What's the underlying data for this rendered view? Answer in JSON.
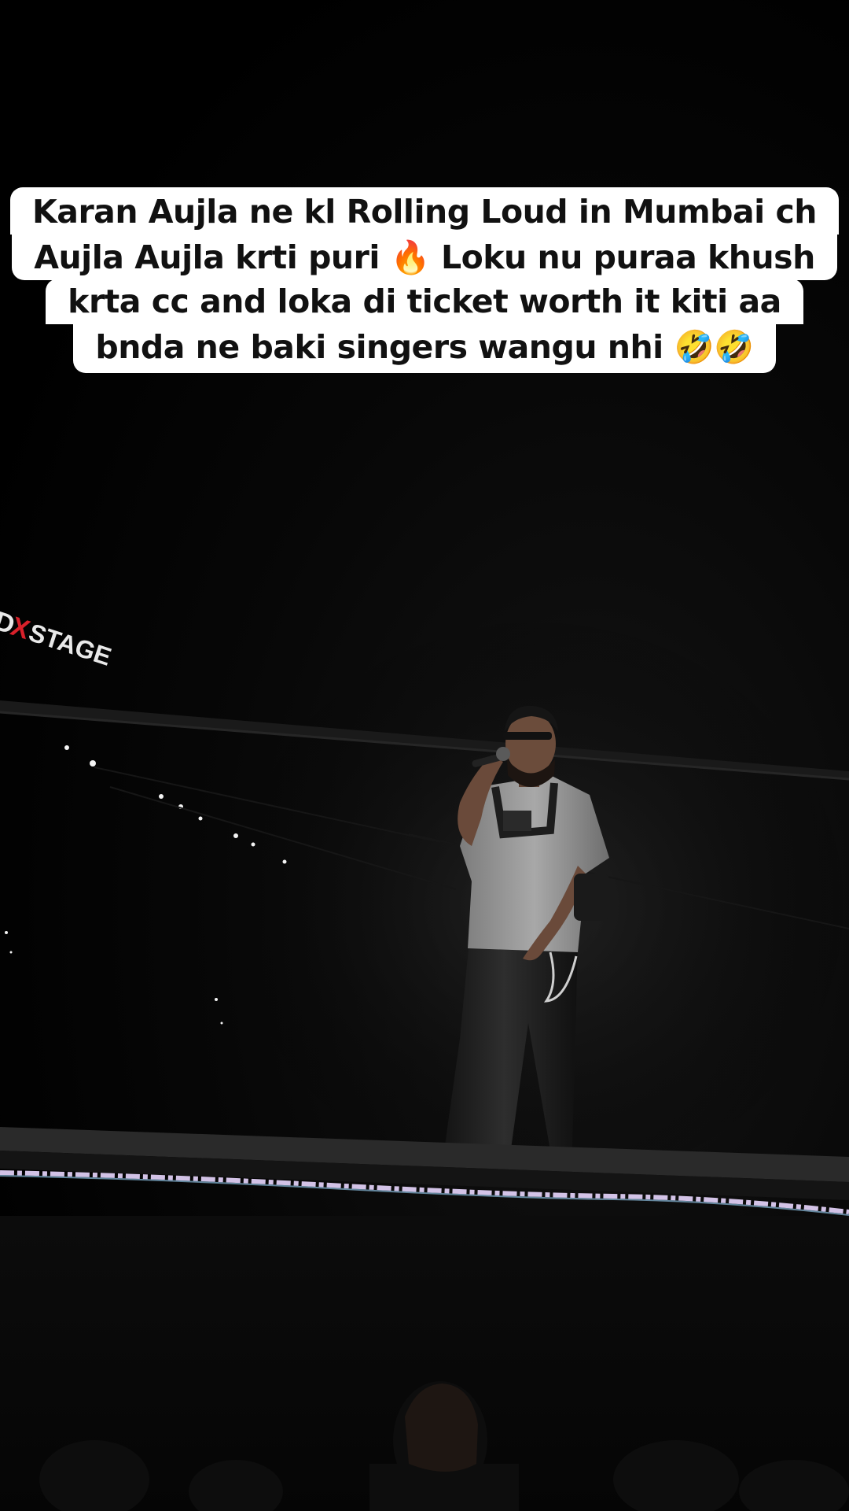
{
  "caption": {
    "line1": "Karan Aujla ne kl Rolling Loud in Mumbai ch",
    "line2": "Aujla Aujla krti puri 🔥 Loku nu puraa khush",
    "line3": "krta cc and loka di ticket worth it kiti aa",
    "line4": "bnda ne baki singers wangu nhi 🤣🤣"
  },
  "stage_sign": {
    "text_white_1": "D",
    "text_red": "X",
    "text_white_2": "STAGE"
  },
  "colors": {
    "caption_bg": "#ffffff",
    "caption_text": "#111111",
    "background": "#000000",
    "shirt": "#9a9a9a",
    "pants": "#1e1e1e",
    "stage_lights": "#e9d7ff"
  }
}
